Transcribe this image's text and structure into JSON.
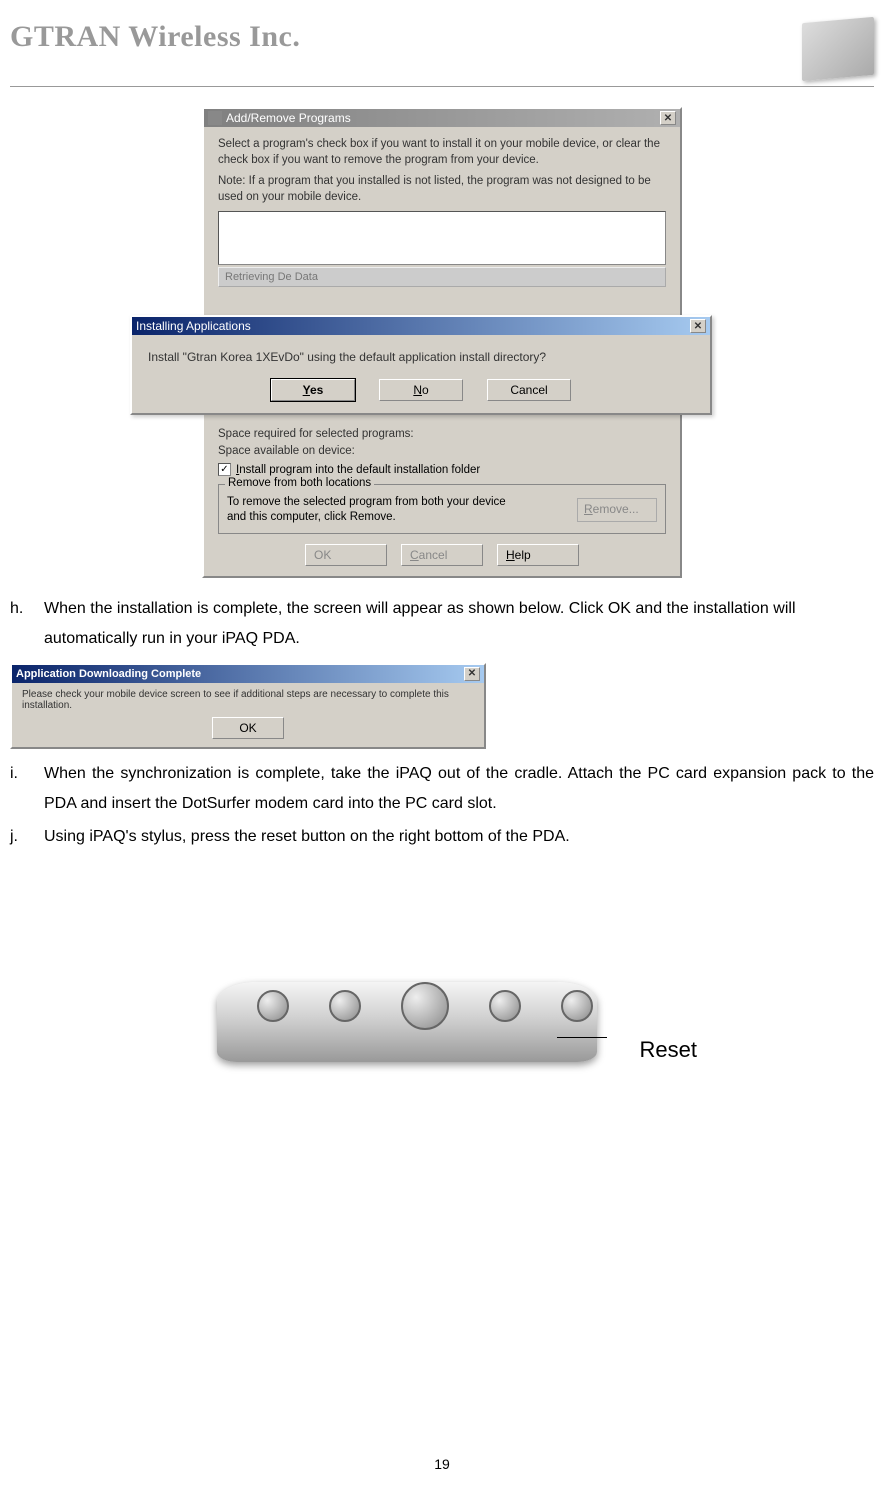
{
  "header": {
    "company": "GTRAN Wireless Inc."
  },
  "window1": {
    "title": "Add/Remove Programs",
    "instr1": "Select a program's check box if you want to install it on your mobile device, or clear the check box if you want to remove the program from your device.",
    "instr2": "Note:  If a program that you installed is not listed, the program was not designed to be used on your mobile device.",
    "retrieving": "Retrieving De        Data",
    "space1": "Space required for selected programs:",
    "space2": "Space available on device:",
    "checkbox_label": "Install program into the default installation folder",
    "groupbox_label": "Remove from both locations",
    "groupbox_text": "To remove the selected program from both your device and this computer, click Remove.",
    "btn_remove": "Remove...",
    "btn_ok": "OK",
    "btn_cancel": "Cancel",
    "btn_help": "Help"
  },
  "dialog": {
    "title": "Installing Applications",
    "text": "Install \"Gtran Korea 1XEvDo\" using the default application install directory?",
    "btn_yes": "Yes",
    "btn_no": "No",
    "btn_cancel": "Cancel"
  },
  "list": {
    "h_marker": "h.",
    "h_text": "When the installation is complete, the screen will appear as shown below. Click OK and the installation will automatically run in your iPAQ PDA.",
    "i_marker": "i.",
    "i_text": "When the synchronization is complete, take the iPAQ out of the cradle. Attach the PC card expansion pack to the PDA and insert the DotSurfer modem card into the PC card slot.",
    "j_marker": "j.",
    "j_text": "Using iPAQ's stylus, press the reset button on the right bottom of the PDA."
  },
  "window2": {
    "title": "Application Downloading Complete",
    "text": "Please check your mobile device screen to see if additional steps are necessary to complete this installation.",
    "btn_ok": "OK"
  },
  "pda": {
    "reset_label": "Reset"
  },
  "page_number": "19"
}
